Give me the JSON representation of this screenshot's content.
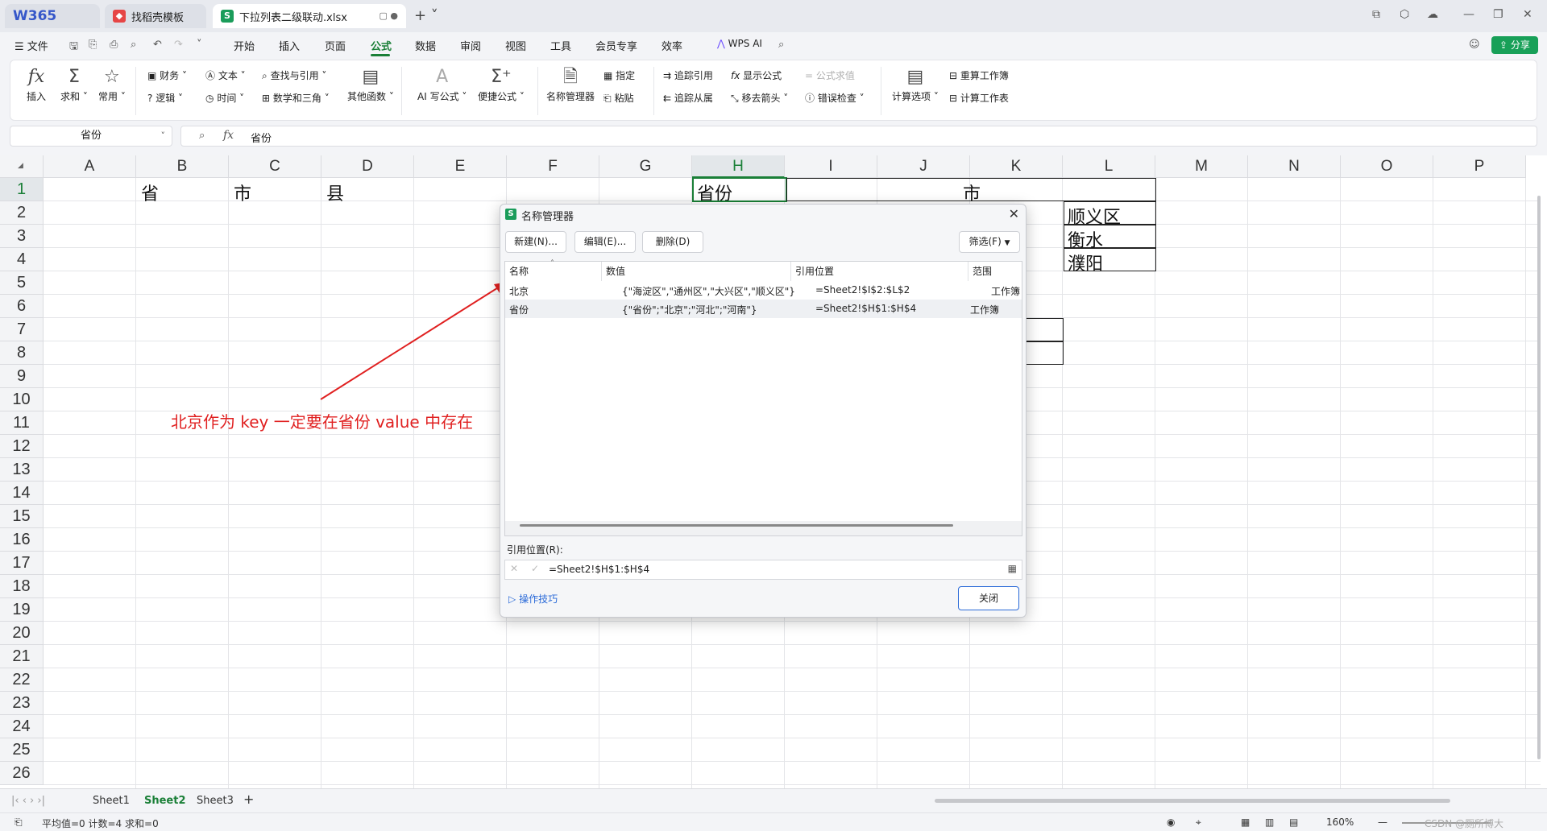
{
  "tabs": {
    "w365": "W365",
    "template": "找稻壳模板",
    "file": "下拉列表二级联动.xlsx"
  },
  "menu": {
    "file": "文件",
    "items": [
      "开始",
      "插入",
      "页面",
      "公式",
      "数据",
      "审阅",
      "视图",
      "工具",
      "会员专享",
      "效率"
    ],
    "wps_ai": "WPS AI",
    "share": "分享"
  },
  "ribbon": {
    "insert": "插入",
    "sum": "求和",
    "common": "常用",
    "finance": "财务",
    "text": "文本",
    "lookup": "查找与引用",
    "logic": "逻辑",
    "time": "时间",
    "math": "数学和三角",
    "other": "其他函数",
    "ai_formula": "AI 写公式",
    "quick_formula": "便捷公式",
    "name_manager": "名称管理器",
    "specify": "指定",
    "paste": "粘贴",
    "trace_prec": "追踪引用",
    "trace_dep": "追踪从属",
    "show_formula": "显示公式",
    "remove_arrows": "移去箭头",
    "eval_formula": "公式求值",
    "error_check": "错误检查",
    "calc_options": "计算选项",
    "recalc_book": "重算工作簿",
    "calc_sheet": "计算工作表"
  },
  "formula_bar": {
    "name_box": "省份",
    "fx": "fx",
    "content": "省份"
  },
  "columns": [
    "A",
    "B",
    "C",
    "D",
    "E",
    "F",
    "G",
    "H",
    "I",
    "J",
    "K",
    "L",
    "M",
    "N",
    "O",
    "P"
  ],
  "rows": [
    "1",
    "2",
    "3",
    "4",
    "5",
    "6",
    "7",
    "8",
    "9",
    "10",
    "11",
    "12",
    "13",
    "14",
    "15",
    "16",
    "17",
    "18",
    "19",
    "20",
    "21",
    "22",
    "23",
    "24",
    "25",
    "26"
  ],
  "cells": {
    "b1": "省",
    "c1": "市",
    "d1": "县",
    "h1": "省份",
    "j1": "市",
    "l2": "顺义区",
    "l3": "衡水",
    "l4": "濮阳"
  },
  "annotation": "北京作为 key 一定要在省份 value 中存在",
  "dialog": {
    "title": "名称管理器",
    "new": "新建(N)...",
    "edit": "编辑(E)...",
    "delete": "删除(D)",
    "filter": "筛选(F)",
    "headers": [
      "名称",
      "数值",
      "引用位置",
      "范围"
    ],
    "rows": [
      {
        "name": "北京",
        "value": "{\"海淀区\",\"通州区\",\"大兴区\",\"顺义区\"}",
        "ref": "=Sheet2!$I$2:$L$2",
        "scope": "工作簿"
      },
      {
        "name": "省份",
        "value": "{\"省份\";\"北京\";\"河北\";\"河南\"}",
        "ref": "=Sheet2!$H$1:$H$4",
        "scope": "工作簿"
      }
    ],
    "ref_label": "引用位置(R):",
    "ref_value": "=Sheet2!$H$1:$H$4",
    "tips": "操作技巧",
    "close": "关闭"
  },
  "sheets": [
    "Sheet1",
    "Sheet2",
    "Sheet3"
  ],
  "status": {
    "summary": "平均值=0  计数=4  求和=0",
    "zoom": "160%",
    "watermark": "CSDN @厕所博大"
  }
}
